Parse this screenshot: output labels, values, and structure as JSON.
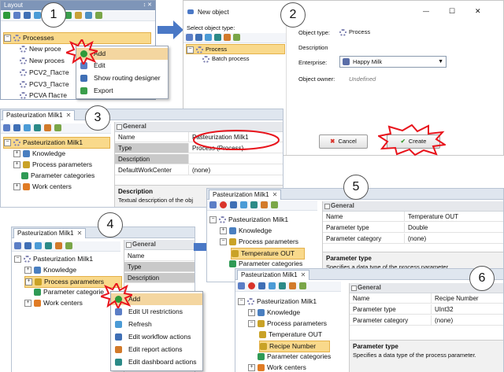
{
  "steps": {
    "s1": "1",
    "s2": "2",
    "s3": "3",
    "s4": "4",
    "s5": "5",
    "s6": "6"
  },
  "layout_panel": {
    "title": "Layout",
    "pin": "↕ ✕",
    "tree": {
      "root": "Processes",
      "items": [
        "New proce",
        "New proces",
        "PCV2_Пасте",
        "PCV3_Пасте",
        "PCVA Пасте"
      ]
    },
    "context_menu": [
      "Add",
      "Edit",
      "Show routing designer",
      "Export"
    ]
  },
  "new_object": {
    "title": "New object",
    "select_label": "Select object type:",
    "tree_root": "Process",
    "tree_child": "Batch process",
    "object_type_label": "Object type:",
    "object_type_value": "Process",
    "description_label": "Description",
    "enterprise_label": "Enterprise:",
    "enterprise_value": "Happy Milk",
    "owner_label": "Object owner:",
    "owner_value": "Undefined",
    "cancel": "Cancel",
    "create": "Create",
    "win_controls": [
      "—",
      "☐",
      "✕"
    ]
  },
  "step3": {
    "tab": "Pasteurization Milk1",
    "tree_root": "Pasteurization Milk1",
    "tree_items": [
      "Knowledge",
      "Process parameters",
      "Parameter categories",
      "Work centers"
    ],
    "group": "General",
    "props": [
      {
        "k": "Name",
        "v": "Pasteurization Milk1"
      },
      {
        "k": "Type",
        "v": "Process (Process)"
      },
      {
        "k": "Description",
        "v": ""
      },
      {
        "k": "DefaultWorkCenter",
        "v": "(none)"
      }
    ],
    "desc_title": "Description",
    "desc_text": "Textual description of the obj"
  },
  "step4": {
    "tab": "Pasteurization Milk1",
    "tree_root": "Pasteurization Milk1",
    "tree_items": [
      "Knowledge",
      "Process parameters",
      "Parameter categorie",
      "Work centers"
    ],
    "group": "General",
    "props": [
      "Name",
      "Type",
      "Description"
    ],
    "context_menu": [
      "Add",
      "Edit UI restrictions",
      "Refresh",
      "Edit workflow actions",
      "Edit report actions",
      "Edit dashboard actions"
    ]
  },
  "step5": {
    "tab": "Pasteurization Milk1",
    "tree_items": [
      "Pasteurization Milk1",
      "Knowledge",
      "Process parameters",
      "Temperature OUT",
      "Parameter categories"
    ],
    "group": "General",
    "props": [
      {
        "k": "Name",
        "v": "Temperature OUT"
      },
      {
        "k": "Parameter type",
        "v": "Double"
      },
      {
        "k": "Parameter category",
        "v": "(none)"
      }
    ],
    "desc_title": "Parameter type",
    "desc_text": "Specifies a data type of the process parameter."
  },
  "step6": {
    "tab": "Pasteurization Milk1",
    "tree_items": [
      "Pasteurization Milk1",
      "Knowledge",
      "Process parameters",
      "Temperature OUT",
      "Recipe Number",
      "Parameter categories",
      "Work centers"
    ],
    "group": "General",
    "props": [
      {
        "k": "Name",
        "v": "Recipe Number"
      },
      {
        "k": "Parameter type",
        "v": "UInt32"
      },
      {
        "k": "Parameter category",
        "v": "(none)"
      }
    ],
    "desc_title": "Parameter type",
    "desc_text": "Specifies a data type of the process parameter."
  },
  "colors": {
    "arrow": "#4a78c6",
    "burst": "#e8141c",
    "selection": "#f9d98b",
    "cancel_x": "#d9342b",
    "create_check": "#3a9a2f"
  }
}
